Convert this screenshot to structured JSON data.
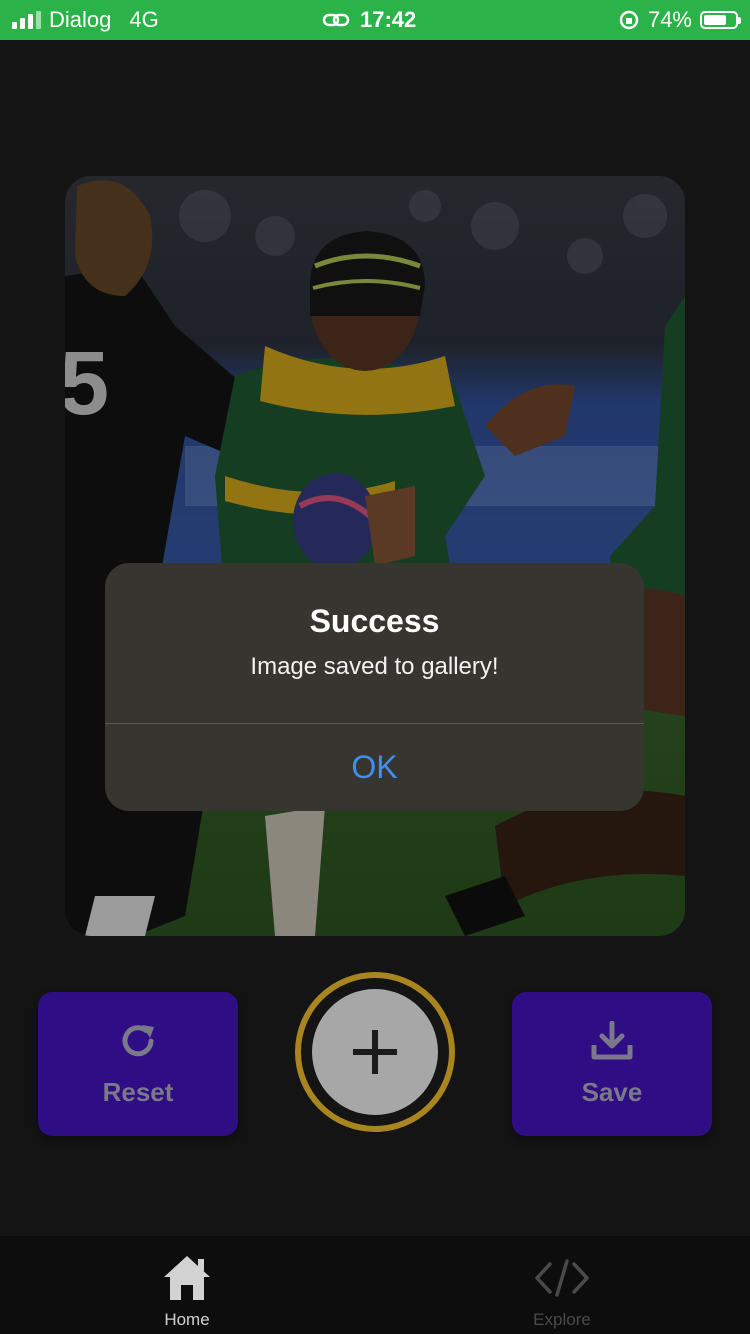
{
  "status_bar": {
    "carrier": "Dialog",
    "network": "4G",
    "time": "17:42",
    "battery_percent": "74%",
    "battery_level": 0.74,
    "color": "#2bb34a"
  },
  "alert": {
    "title": "Success",
    "message": "Image saved to gallery!",
    "ok_label": "OK",
    "ok_color": "#3d8ff0"
  },
  "actions": {
    "reset_label": "Reset",
    "save_label": "Save",
    "reset_icon": "refresh-icon",
    "save_icon": "download-icon",
    "add_icon": "plus-icon",
    "button_color": "#2e0d85",
    "ring_color": "#a8851f"
  },
  "tabs": [
    {
      "label": "Home",
      "icon": "home-icon",
      "active": true
    },
    {
      "label": "Explore",
      "icon": "code-icon",
      "active": false
    }
  ]
}
